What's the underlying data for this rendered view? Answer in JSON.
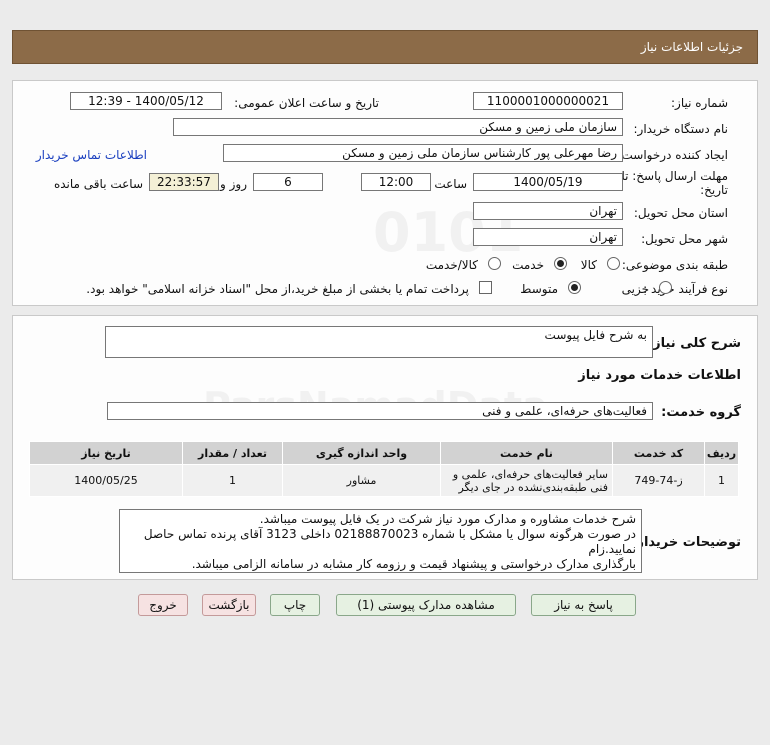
{
  "page_title": "جزئیات اطلاعات نیاز",
  "info": {
    "need_number_label": "شماره نیاز:",
    "need_number": "1100001000000021",
    "announce_label": "تاریخ و ساعت اعلان عمومی:",
    "announce_value": "1400/05/12 - 12:39",
    "buyer_org_label": "نام دستگاه خریدار:",
    "buyer_org": "سازمان ملی زمین و مسکن",
    "requester_label": "ایجاد کننده درخواست:",
    "requester": "رضا مهرعلی پور کارشناس سازمان ملی زمین و مسکن",
    "contact_link": "اطلاعات تماس خریدار",
    "deadline_label_1": "مهلت ارسال پاسخ: تا",
    "deadline_label_2": "تاریخ:",
    "deadline_date": "1400/05/19",
    "time_label": "ساعت",
    "deadline_time": "12:00",
    "days_value": "6",
    "days_label": "روز و",
    "remaining_time": "22:33:57",
    "remaining_label": "ساعت باقی مانده",
    "province_label": "استان محل تحویل:",
    "province": "تهران",
    "city_label": "شهر محل تحویل:",
    "city": "تهران",
    "category_label": "طبقه بندی موضوعی:",
    "category_options": [
      "کالا",
      "خدمت",
      "کالا/خدمت"
    ],
    "category_selected": "خدمت",
    "process_label": "نوع فرآیند خرید :",
    "process_options": [
      "جزیی",
      "متوسط"
    ],
    "process_selected": "متوسط",
    "payment_note": "پرداخت تمام یا بخشی از مبلغ خرید،از محل \"اسناد خزانه اسلامی\" خواهد بود."
  },
  "details": {
    "summary_label": "شرح کلی نیاز:",
    "summary": "به شرح فایل پیوست",
    "services_heading": "اطلاعات خدمات مورد نیاز",
    "service_group_label": "گروه خدمت:",
    "service_group": "فعالیت‌های حرفه‌ای، علمی و فنی",
    "table": {
      "headers": [
        "ردیف",
        "کد خدمت",
        "نام خدمت",
        "واحد اندازه گیری",
        "تعداد / مقدار",
        "تاریخ نیاز"
      ],
      "rows": [
        [
          "1",
          "ز-74-749",
          "سایر فعالیت‌های حرفه‌ای، علمی و فنی طبقه‌بندی‌نشده در جای دیگر",
          "مشاور",
          "1",
          "1400/05/25"
        ]
      ]
    },
    "buyer_desc_label": "توضیحات خریدار:",
    "buyer_desc_lines": [
      "شرح خدمات مشاوره و مدارک مورد نیاز شرکت در یک فایل پیوست میباشد.",
      "در صورت هرگونه سوال یا مشکل با شماره 02188870023 داخلی 3123 آقای پرنده تماس حاصل نمایید.زام",
      "بارگذاری مدارک درخواستی و پیشنهاد قیمت و رزومه کار مشابه در سامانه الزامی میباشد."
    ]
  },
  "buttons": {
    "reply": "پاسخ به نیاز",
    "view_docs": "مشاهده مدارک پیوستی (1)",
    "print": "چاپ",
    "back": "بازگشت",
    "exit": "خروج"
  },
  "colors": {
    "header_bg": "#8c6b48",
    "link": "#1a3fbf",
    "remaining_bg": "#f4f0d6"
  }
}
